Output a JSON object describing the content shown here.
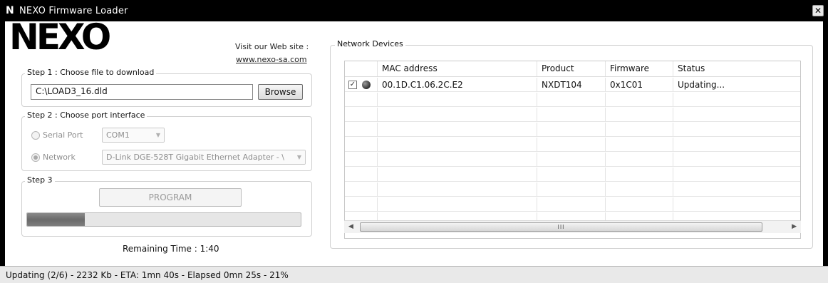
{
  "window": {
    "title": "NEXO Firmware Loader",
    "icon": "N"
  },
  "logo": {
    "text": "NEXO"
  },
  "website": {
    "label": "Visit our Web site :",
    "link": "www.nexo-sa.com"
  },
  "step1": {
    "legend": "Step 1 : Choose file to download",
    "file_path": "C:\\LOAD3_16.dld",
    "browse_label": "Browse"
  },
  "step2": {
    "legend": "Step 2 : Choose port interface",
    "serial_label": "Serial Port",
    "serial_value": "COM1",
    "network_label": "Network",
    "network_value": "D-Link DGE-528T Gigabit Ethernet Adapter - \\"
  },
  "step3": {
    "legend": "Step 3",
    "program_label": "PROGRAM",
    "progress": 0.21
  },
  "remaining_time": "Remaining Time : 1:40",
  "network_devices": {
    "legend": "Network Devices",
    "columns": [
      "",
      "MAC address",
      "Product",
      "Firmware",
      "Status"
    ],
    "rows": [
      {
        "checked": true,
        "mac": "00.1D.C1.06.2C.E2",
        "product": "NXDT104",
        "firmware": "0x1C01",
        "status": "Updating..."
      }
    ],
    "scroll_grip": "III"
  },
  "status_bar": "Updating (2/6) - 2232 Kb - ETA: 1mn 40s - Elapsed 0mn 25s - 21%",
  "colors": {
    "titlebar": "#000000",
    "progress_fill": "#7a7a7a",
    "statusbar": "#e9e9e9"
  }
}
